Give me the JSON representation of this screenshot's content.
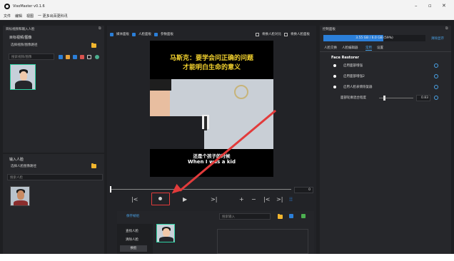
{
  "window": {
    "title": "VisoMaster v0.1.6",
    "min": "–",
    "max": "▫",
    "close": "✕"
  },
  "menu": {
    "items": [
      "文件",
      "编辑",
      "视图",
      "一 更多出百更科讯"
    ]
  },
  "left_panel": {
    "header": "目标视频和输入人脸",
    "target_section": "目标视频/图像",
    "target_field": "选择视频/图像路径",
    "search_placeholder": "搜索视频/图像",
    "input_section": "输入人脸",
    "input_field": "选择人脸图像路径",
    "input_search": "搜索人脸"
  },
  "top_options": {
    "left": [
      "媒体面板",
      "人脸面板",
      "参数面板"
    ],
    "right": [
      "将换人脸对比",
      "将换人脸面板"
    ]
  },
  "video": {
    "caption_line1": "马斯克：要学会问正确的问题",
    "caption_line2": "才能明白生命的意义",
    "sub_cn": "还是个孩子的时候",
    "sub_en": "When I was a kid",
    "frame_value": "0"
  },
  "controls": {
    "prev": "|<",
    "next": ">|",
    "play": "▶",
    "record": "●",
    "plus": "+",
    "minus": "−",
    "back": "|<",
    "fwd": ">|",
    "grid": "⁞⁞"
  },
  "bottom": {
    "saved_title": "保存帧组",
    "search_placeholder": "搜索输入",
    "find_faces": "查找人脸",
    "clear_faces": "清除人脸",
    "swap_button": "换脸"
  },
  "right_panel": {
    "header": "控制面板",
    "memory": "3.55 GB / 6.0 GB (59%)",
    "clear_mem": "清除显存",
    "tabs": [
      "人脸交换",
      "人脸编辑器",
      "常用",
      "设置"
    ],
    "face_restorer_title": "Face Restorer",
    "options": [
      "启用面部增强",
      "启用面部增强2",
      "启用人脸表情恢复器"
    ],
    "slider_label": "面部轮廓混合程度",
    "slider_value": "0.83",
    "slider_fraction": 0.12
  },
  "colors": {
    "panel": "#26272b",
    "accent": "#2b7fd9",
    "caption": "#f2d12e",
    "arrow": "#e23b3b",
    "folder": "#f2b62e"
  }
}
